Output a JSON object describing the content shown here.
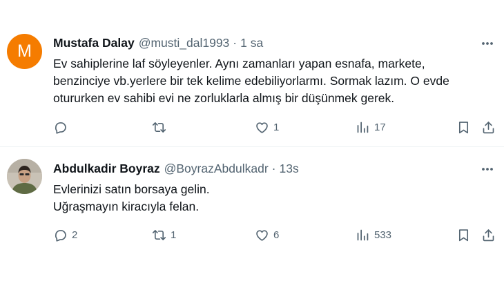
{
  "tweets": [
    {
      "avatar_letter": "M",
      "avatar_color": "#f57c00",
      "name": "Mustafa Dalay",
      "handle": "@musti_dal1993",
      "separator": "·",
      "time": "1 sa",
      "text_lines": [
        "Ev sahiplerine laf söyleyenler. Aynı zamanları yapan esnafa, markete,",
        "benzinciye vb.yerlere bir tek kelime edebiliyorlarmı. Sormak lazım. O evde",
        "otururken ev sahibi evi ne zorluklarla almış bir düşünmek gerek."
      ],
      "counts": {
        "replies": "",
        "retweets": "",
        "likes": "1",
        "views": "17"
      }
    },
    {
      "name": "Abdulkadir Boyraz",
      "handle": "@BoyrazAbdulkadr",
      "separator": "·",
      "time": "13s",
      "text_lines": [
        "Evlerinizi satın borsaya gelin.",
        "Uğraşmayın kiracıyla felan."
      ],
      "counts": {
        "replies": "2",
        "retweets": "1",
        "likes": "6",
        "views": "533"
      }
    }
  ],
  "icons": {
    "more": "more-icon",
    "reply": "reply-icon",
    "retweet": "retweet-icon",
    "like": "like-icon",
    "views": "views-icon",
    "bookmark": "bookmark-icon",
    "share": "share-icon"
  },
  "colors": {
    "text_primary": "#0f1419",
    "text_secondary": "#536471",
    "divider": "#eff3f4"
  }
}
